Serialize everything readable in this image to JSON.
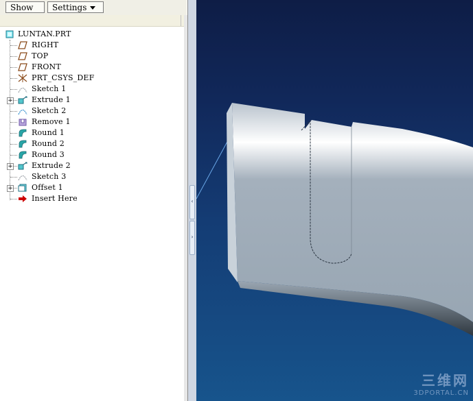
{
  "toolbar": {
    "show_label": "Show",
    "settings_label": "Settings"
  },
  "model_tree": {
    "root": "LUNTAN.PRT",
    "items": [
      {
        "label": "RIGHT",
        "icon": "datum-plane-icon",
        "expandable": false
      },
      {
        "label": "TOP",
        "icon": "datum-plane-icon",
        "expandable": false
      },
      {
        "label": "FRONT",
        "icon": "datum-plane-icon",
        "expandable": false
      },
      {
        "label": "PRT_CSYS_DEF",
        "icon": "csys-icon",
        "expandable": false
      },
      {
        "label": "Sketch 1",
        "icon": "sketch-icon",
        "expandable": false
      },
      {
        "label": "Extrude 1",
        "icon": "extrude-icon",
        "expandable": true
      },
      {
        "label": "Sketch 2",
        "icon": "sketch-icon",
        "expandable": false
      },
      {
        "label": "Remove 1",
        "icon": "remove-icon",
        "expandable": false
      },
      {
        "label": "Round 1",
        "icon": "round-icon",
        "expandable": false
      },
      {
        "label": "Round 2",
        "icon": "round-icon",
        "expandable": false
      },
      {
        "label": "Round 3",
        "icon": "round-icon",
        "expandable": false
      },
      {
        "label": "Extrude 2",
        "icon": "extrude-icon",
        "expandable": true
      },
      {
        "label": "Sketch 3",
        "icon": "sketch-icon",
        "expandable": false
      },
      {
        "label": "Offset 1",
        "icon": "offset-icon",
        "expandable": true
      },
      {
        "label": "Insert Here",
        "icon": "insert-here-arrow-icon",
        "expandable": false
      }
    ]
  },
  "viewport": {
    "background_top": "#0e1d46",
    "background_bottom": "#17548c",
    "model_color": "#a8b4c0"
  },
  "watermark": {
    "line1": "三维网",
    "line2": "3DPORTAL.CN"
  },
  "colors": {
    "insert_arrow": "#cc0000",
    "datum_plane": "#8a4a1a",
    "feature_icon": "#2aa6a8"
  }
}
